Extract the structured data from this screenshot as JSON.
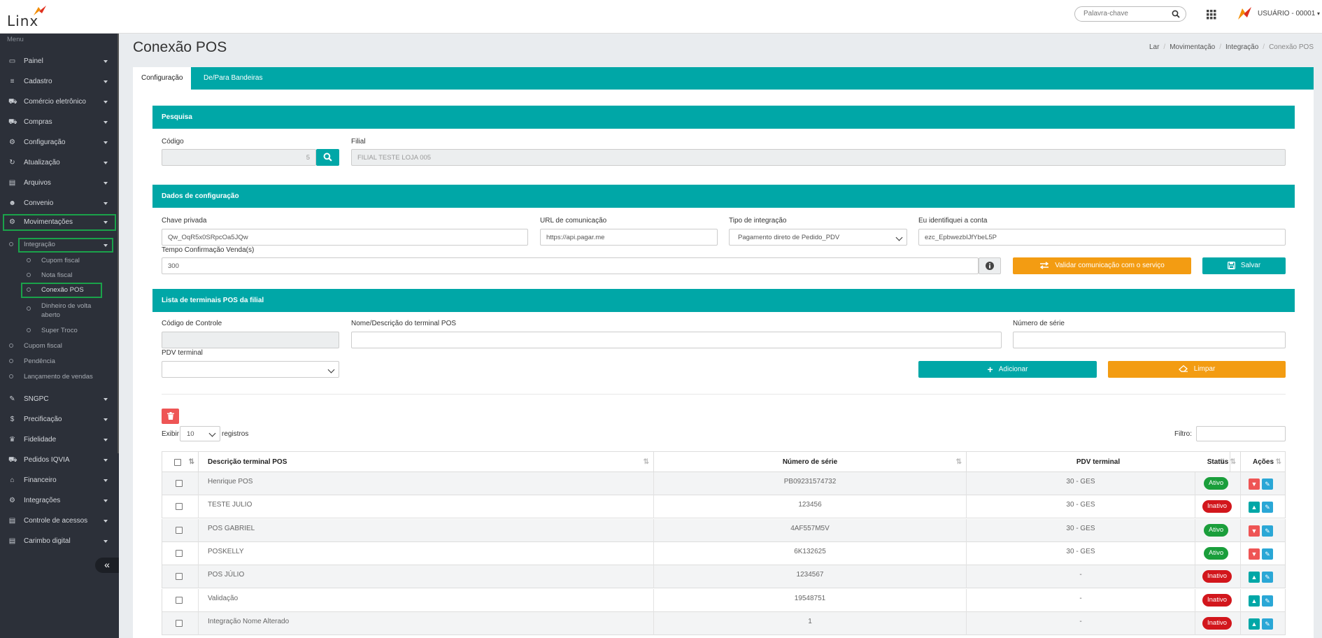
{
  "app": {
    "logo_text": "Linx"
  },
  "header": {
    "search_placeholder": "Palavra-chave",
    "user": "USUÁRIO - 00001"
  },
  "sidebar": {
    "caption": "Menu",
    "items": [
      {
        "label": "Painel",
        "icon": "laptop-icon"
      },
      {
        "label": "Cadastro",
        "icon": "database-icon"
      },
      {
        "label": "Comércio eletrônico",
        "icon": "cart-icon"
      },
      {
        "label": "Compras",
        "icon": "cart-icon"
      },
      {
        "label": "Configuração",
        "icon": "gear-icon"
      },
      {
        "label": "Atualização",
        "icon": "refresh-icon"
      },
      {
        "label": "Arquivos",
        "icon": "file-icon"
      },
      {
        "label": "Convenio",
        "icon": "users-icon"
      },
      {
        "label": "Movimentações",
        "icon": "gears-icon"
      }
    ],
    "sub_integracao": "Integração",
    "sub_items": [
      "Cupom fiscal",
      "Nota fiscal",
      "Conexão POS",
      "Dinheiro de volta",
      "aberto",
      "Super Troco"
    ],
    "mov_items": [
      "Cupom fiscal",
      "Pendência",
      "Lançamento de vendas"
    ],
    "items2": [
      {
        "label": "SNGPC",
        "icon": "pencil-icon"
      },
      {
        "label": "Precificação",
        "icon": "dollar-icon"
      },
      {
        "label": "Fidelidade",
        "icon": "trophy-icon"
      },
      {
        "label": "Pedidos IQVIA",
        "icon": "cart-icon"
      },
      {
        "label": "Financeiro",
        "icon": "bank-icon"
      },
      {
        "label": "Integrações",
        "icon": "gears-icon"
      },
      {
        "label": "Controle de acessos",
        "icon": "file-icon"
      },
      {
        "label": "Carimbo digital",
        "icon": "file-icon"
      }
    ],
    "collapse": "«"
  },
  "page": {
    "title": "Conexão POS",
    "breadcrumb": [
      "Lar",
      "Movimentação",
      "Integração",
      "Conexão POS"
    ]
  },
  "tabs": [
    "Configuração",
    "De/Para Bandeiras"
  ],
  "pesquisa": {
    "heading": "Pesquisa",
    "codigo_label": "Código",
    "codigo_value": "5",
    "filial_label": "Filial",
    "filial_value": "FILIAL TESTE LOJA 005"
  },
  "config": {
    "heading": "Dados de configuração",
    "chave_label": "Chave privada",
    "chave_value": "Qw_OqR5x0SRpcOa5JQw",
    "url_label": "URL de comunicação",
    "url_value": "https://api.pagar.me",
    "tipo_label": "Tipo de integração",
    "tipo_value": "Pagamento direto de Pedido_PDV",
    "conta_label": "Eu identifiquei a conta",
    "conta_value": "ezc_EpbwezbIJfYbeL5P",
    "tempo_label": "Tempo Confirmação Venda(s)",
    "tempo_value": "300",
    "validar_label": "Validar comunicação com o serviço",
    "salvar_label": "Salvar"
  },
  "terminais": {
    "heading": "Lista de terminais POS da filial",
    "codigo_label": "Código de Controle",
    "nome_label": "Nome/Descrição do terminal POS",
    "serie_label": "Número de série",
    "pdv_label": "PDV terminal",
    "adicionar_label": "Adicionar",
    "limpar_label": "Limpar",
    "exibir_label": "Exibir",
    "exibir_value": "10",
    "registros_label": "registros",
    "filtro_label": "Filtro:"
  },
  "table": {
    "columns": [
      "Descrição terminal POS",
      "Número de série",
      "PDV terminal",
      "Status",
      "Ações"
    ],
    "rows": [
      {
        "desc": "Henrique POS",
        "serie": "PB09231574732",
        "pdv": "30 - GES",
        "status": "Ativo"
      },
      {
        "desc": "TESTE JULIO",
        "serie": "123456",
        "pdv": "30 - GES",
        "status": "Inativo"
      },
      {
        "desc": "POS GABRIEL",
        "serie": "4AF557M5V",
        "pdv": "30 - GES",
        "status": "Ativo"
      },
      {
        "desc": "POSKELLY",
        "serie": "6K132625",
        "pdv": "30 - GES",
        "status": "Ativo"
      },
      {
        "desc": "POS JÚLIO",
        "serie": "1234567",
        "pdv": "-",
        "status": "Inativo"
      },
      {
        "desc": "Validação",
        "serie": "19548751",
        "pdv": "-",
        "status": "Inativo"
      },
      {
        "desc": "Integração Nome Alterado",
        "serie": "1",
        "pdv": "-",
        "status": "Inativo"
      }
    ]
  },
  "colors": {
    "teal": "#00a7a7",
    "orange": "#f39c12",
    "green_highlight": "#1aa24a",
    "sidebar": "#2c3039"
  }
}
